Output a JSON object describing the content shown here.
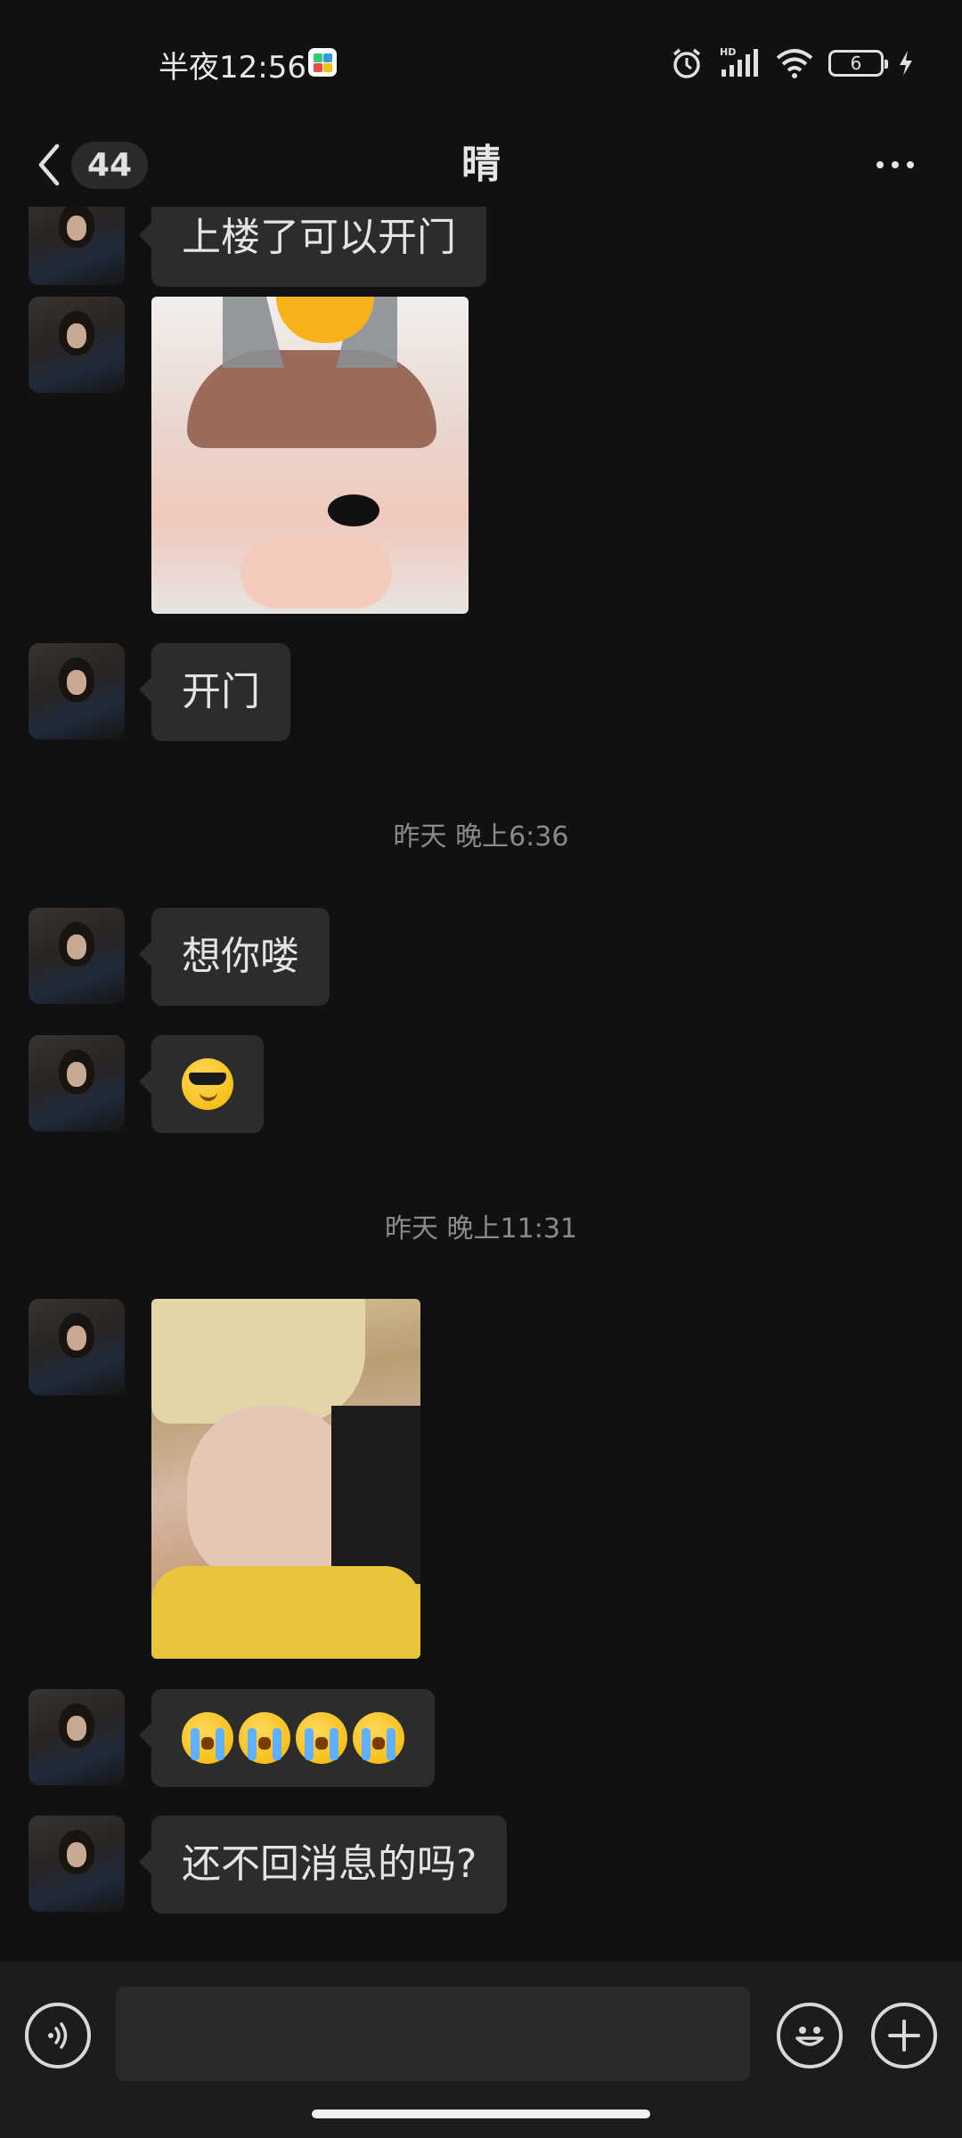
{
  "status_bar": {
    "time": "半夜12:56",
    "battery_level": "6",
    "network_badge": "HD"
  },
  "header": {
    "unread_count": "44",
    "title": "晴"
  },
  "messages": [
    {
      "type": "text",
      "text": "上楼了可以开门"
    },
    {
      "type": "image",
      "alt": "sticker-photo"
    },
    {
      "type": "text",
      "text": "开门"
    },
    {
      "type": "timestamp",
      "text": "昨天 晚上6:36"
    },
    {
      "type": "text",
      "text": "想你喽"
    },
    {
      "type": "emoji",
      "icon": "sunglasses-emoji"
    },
    {
      "type": "timestamp",
      "text": "昨天 晚上11:31"
    },
    {
      "type": "image",
      "alt": "selfie-photo"
    },
    {
      "type": "emoji",
      "icon": "crying-emoji",
      "count": 4
    },
    {
      "type": "text",
      "text": "还不回消息的吗?"
    }
  ],
  "input": {
    "placeholder": ""
  },
  "colors": {
    "background": "#111111",
    "bubble": "#2c2c2c",
    "input_bar": "#1c1c1c"
  }
}
